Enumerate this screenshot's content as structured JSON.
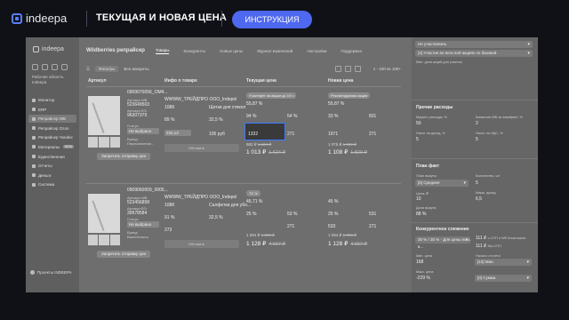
{
  "banner": {
    "logo": "indeepa",
    "title": "ТЕКУЩАЯ И НОВАЯ ЦЕНА",
    "button": "ИНСТРУКЦИЯ",
    "accent": "#4e68ef"
  },
  "sidebar": {
    "logo": "indeepa",
    "work_area": "Рабочая область",
    "work_area_value": "Indeepa",
    "items": [
      {
        "label": "Монитор",
        "icon": "monitor-icon"
      },
      {
        "label": "ERP",
        "icon": "erp-icon"
      },
      {
        "label": "Репрайсер WB",
        "icon": "repricer-icon"
      },
      {
        "label": "Репрайсер Ozon",
        "icon": "repricer-icon"
      },
      {
        "label": "Репрайсер Yandex",
        "icon": "repricer-icon"
      },
      {
        "label": "Материалы",
        "icon": "materials-icon",
        "badge": "NEW"
      },
      {
        "label": "Единственная",
        "icon": "link-icon"
      },
      {
        "label": "Отчеты",
        "icon": "reports-icon"
      },
      {
        "label": "Деньги",
        "icon": "money-icon"
      },
      {
        "label": "Система",
        "icon": "system-icon"
      }
    ],
    "support": "Проекты INDEEPA"
  },
  "main": {
    "app_title": "Wildberries репрайсер",
    "tabs": [
      "Товары",
      "Конкуренты",
      "Новые цены",
      "Журнал изменений",
      "Настройки",
      "Поддержка"
    ],
    "active_tab": 0,
    "toolbar": {
      "filter": "Фильтры",
      "all": "Все аккаунты",
      "pager": "1 - 100  из 100+"
    },
    "columns": [
      "Артикул",
      "Инфо о товаре",
      "Текущая цена",
      "Новая цена"
    ],
    "products": [
      {
        "sku": "0909070056_OM4...",
        "barcode": "Артикул WB",
        "wb_id": "523649503",
        "nm": "Артикул ВЭ",
        "nm_val": "96307379",
        "status": "Не выбрано",
        "status_label": "Статус",
        "brand_label": "Бренд",
        "brand_value": "Переосвоение...",
        "seller": "WWWW_ТРЕЙДПРО ООО_Indepol",
        "rating": "108К",
        "category": "Щетки для стекол",
        "stat1": "89 %",
        "stat2": "32,5 %",
        "stat3": "234,13",
        "stat4": "105 руб",
        "cur_promo": "Участвует на акции до 19 ч",
        "cur_commission": "55,87 %",
        "cur_discount": "94 %",
        "cur_margin": "54 %",
        "cur_stock": "271",
        "cur_input": "1332",
        "cur_price_small": "982 ₽",
        "cur_price_small_old": "1 624 ₽",
        "cur_price_big": "1 013 ₽",
        "cur_price_big_old": "1 624 ₽",
        "new_promo": "Рекомендуемая акция",
        "new_commission": "55,87 %",
        "new_discount": "33 %",
        "new_margin": "831",
        "new_stock": "1971",
        "new_stock2": "271",
        "new_price_small": "1 075 ₽",
        "new_price_small_old": "1 829 ₽",
        "new_price_big": "1 108 ₽",
        "new_price_big_old": "1 829 ₽",
        "repeat_btn": "Запретить отправку цен",
        "update_btn": "Обновить"
      },
      {
        "sku": "0909060009_0005...",
        "barcode": "Артикул WB",
        "wb_id": "523456858",
        "nm": "Артикул ВЭ",
        "nm_val": "39978584",
        "status": "Не выбрано",
        "status_label": "Статус",
        "brand_label": "Бренд",
        "brand_value": "Валентность",
        "seller": "WWWW_ТРЕЙДПРО ООО_Indepol",
        "rating": "108К",
        "category": "Салфетки для убо...",
        "stat1": "91 %",
        "stat2": "32,5 %",
        "stat3": "273",
        "stat4": "",
        "cur_promo": "ТС %",
        "cur_commission": "45,71 %",
        "cur_discount": "25 %",
        "cur_margin": "53 %",
        "cur_stock": "271",
        "cur_input": "",
        "cur_price_small": "1 094 ₽",
        "cur_price_small_old": "1 099 ₽",
        "cur_price_big": "1 128 ₽",
        "cur_price_big_old": "4 667 ₽",
        "new_promo": "",
        "new_commission": "45 %",
        "new_discount": "25 %",
        "new_margin": "531",
        "new_stock": "533",
        "new_stock2": "271",
        "new_price_small": "1 094 ₽",
        "new_price_small_old": "1 099 ₽",
        "new_price_big": "1 128 ₽",
        "new_price_big_old": "4 667 ₽",
        "repeat_btn": "Запретить отправку цен",
        "update_btn": "Обновить"
      }
    ]
  },
  "rpanel": {
    "top_select1": "Не участвовать",
    "top_select2": "[4] Участие во всех вэб-акциях по базовой",
    "top_note": "Мин. доля акций для участия",
    "sec1_title": "Прочие расходы",
    "sec1_label1": "Маркет. расходы, %",
    "sec1_val1": "50",
    "sec1_label2": "Комиссия WB за эквайринг, %",
    "sec1_val2": "2",
    "sec1_label3": "Налог на доход, %",
    "sec1_val3": "5",
    "sec1_label4": "Налог на НДС, %",
    "sec1_val4": "5",
    "sec2_title": "План факт",
    "sec2_label1": "План выкупа",
    "sec2_select": "[5] Среднее",
    "sec2_label2": "Количество, шт",
    "sec2_val2": "5",
    "sec2_label3": "Цена, ₽",
    "sec2_val3": "10",
    "sec2_label4": "Марж. доход",
    "sec2_val4": "6,5",
    "sec2_label5": "Доля выкупа",
    "sec2_val5": "88 %",
    "sec3_title": "Конкурентное слежение",
    "sec3_select": "30 % / 30 % - Для цены есть в...",
    "sec3_price1": "111 ₽",
    "sec3_price1_label": "с СПП и WB Кошельком",
    "sec3_price2": "111 ₽",
    "sec3_price2_label": "без СПП",
    "sec3_label1": "Мин. цена",
    "sec3_val1": "168",
    "sec3_label2": "Начало отсчёта",
    "sec3_select2": "[10] Мин.",
    "sec3_label3": "Макс. цена",
    "sec3_val3": "-229 %",
    "sec3_select3": "[0] Сумма"
  }
}
